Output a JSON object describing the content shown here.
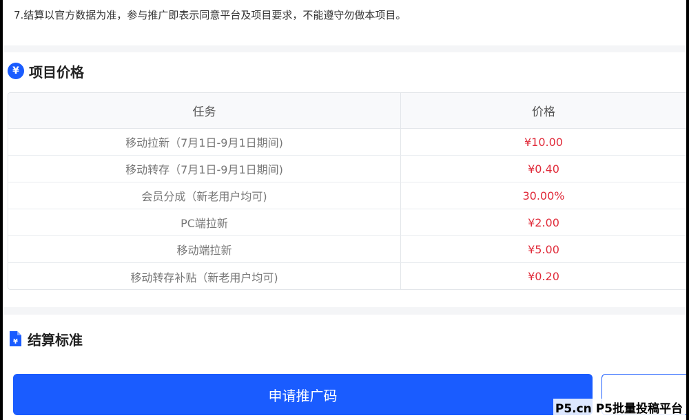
{
  "notice": {
    "text": "7.结算以官方数据为准，参与推广即表示同意平台及项目要求，不能遵守勿做本项目。"
  },
  "price_section": {
    "icon_glyph": "¥",
    "icon": "yen-icon",
    "title": "项目价格",
    "table": {
      "headers": {
        "task": "任务",
        "price": "价格"
      },
      "rows": [
        {
          "task": "移动拉新（7月1日-9月1日期间)",
          "price": "¥10.00"
        },
        {
          "task": "移动转存（7月1日-9月1日期间)",
          "price": "¥0.40"
        },
        {
          "task": "会员分成（新老用户均可)",
          "price": "30.00%"
        },
        {
          "task": "PC端拉新",
          "price": "¥2.00"
        },
        {
          "task": "移动端拉新",
          "price": "¥5.00"
        },
        {
          "task": "移动转存补贴（新老用户均可)",
          "price": "¥0.20"
        }
      ]
    }
  },
  "settle_section": {
    "icon": "document-icon",
    "title": "结算标准"
  },
  "bottom_bar": {
    "apply_label": "申请推广码"
  },
  "watermark": {
    "text": "P5.cn P5批量投稿平台"
  },
  "colors": {
    "accent": "#1a5cff",
    "price_red": "#e02b3a"
  }
}
